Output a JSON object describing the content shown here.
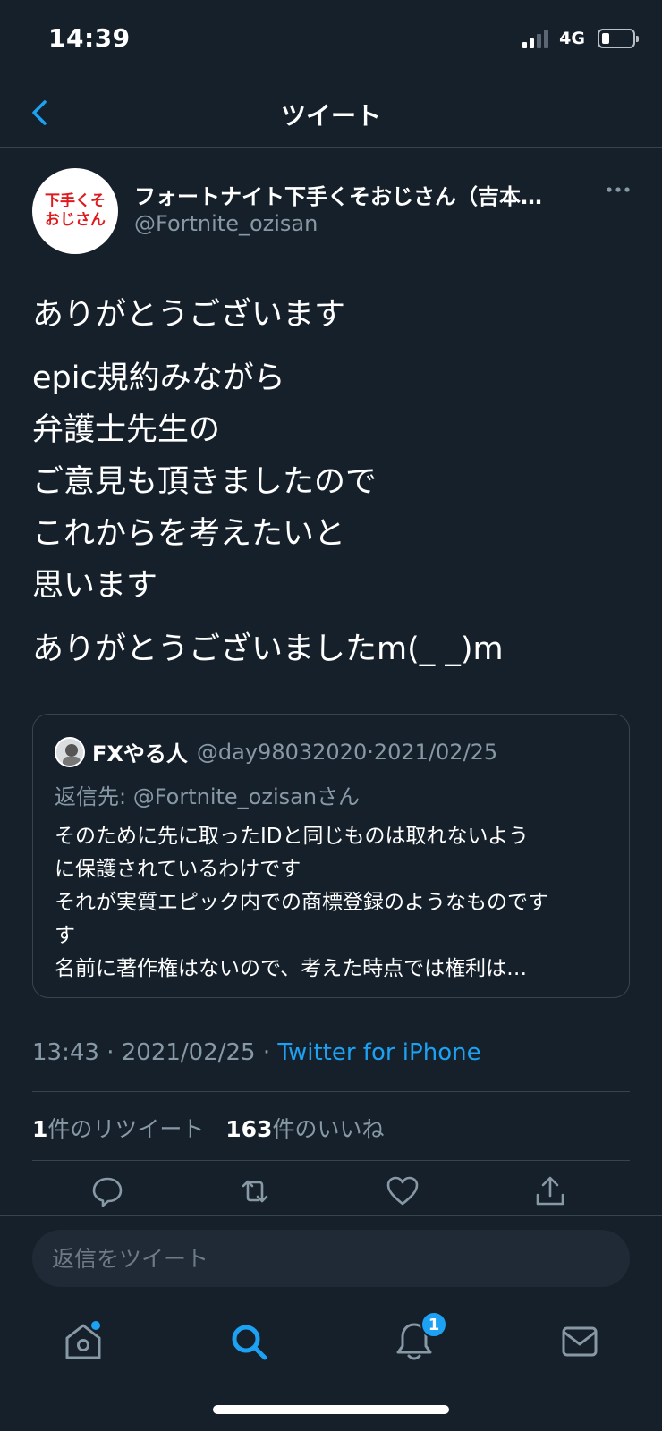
{
  "status_bar": {
    "time": "14:39",
    "network": "4G"
  },
  "header": {
    "title": "ツイート"
  },
  "tweet": {
    "avatar_text_line1": "下手くそ",
    "avatar_text_line2": "おじさん",
    "display_name": "フォートナイト下手くそおじさん（吉本…",
    "handle": "@Fortnite_ozisan",
    "paragraph1": "ありがとうございます",
    "paragraph2_lines": [
      "epic規約みながら",
      "弁護士先生の",
      "ご意見も頂きましたので",
      "これからを考えたいと",
      "思います"
    ],
    "paragraph3": "ありがとうございましたm(_ _)m",
    "time": "13:43",
    "date": "2021/02/25",
    "source": "Twitter for iPhone",
    "retweet_count": "1",
    "retweet_label": "件のリツイート",
    "like_count": "163",
    "like_label": "件のいいね"
  },
  "quote": {
    "name": "FXやる人",
    "handle": "@day98032020",
    "date": "2021/02/25",
    "reply_to": "返信先: @Fortnite_ozisanさん",
    "text_lines": [
      "そのために先に取ったIDと同じものは取れないよう",
      "に保護されているわけです",
      "それが実質エピック内での商標登録のようなものです",
      "す",
      "名前に著作権はないので、考えた時点では権利は…"
    ]
  },
  "reply": {
    "placeholder": "返信をツイート"
  },
  "tabs": {
    "notification_badge": "1"
  },
  "colors": {
    "background": "#15202b",
    "accent": "#1da1f2",
    "secondary_text": "#8899a6",
    "border": "#38444d"
  },
  "icons": [
    "back-chevron-icon",
    "more-icon",
    "reply-icon",
    "retweet-icon",
    "like-icon",
    "share-icon",
    "home-icon",
    "search-icon",
    "notifications-icon",
    "messages-icon"
  ]
}
